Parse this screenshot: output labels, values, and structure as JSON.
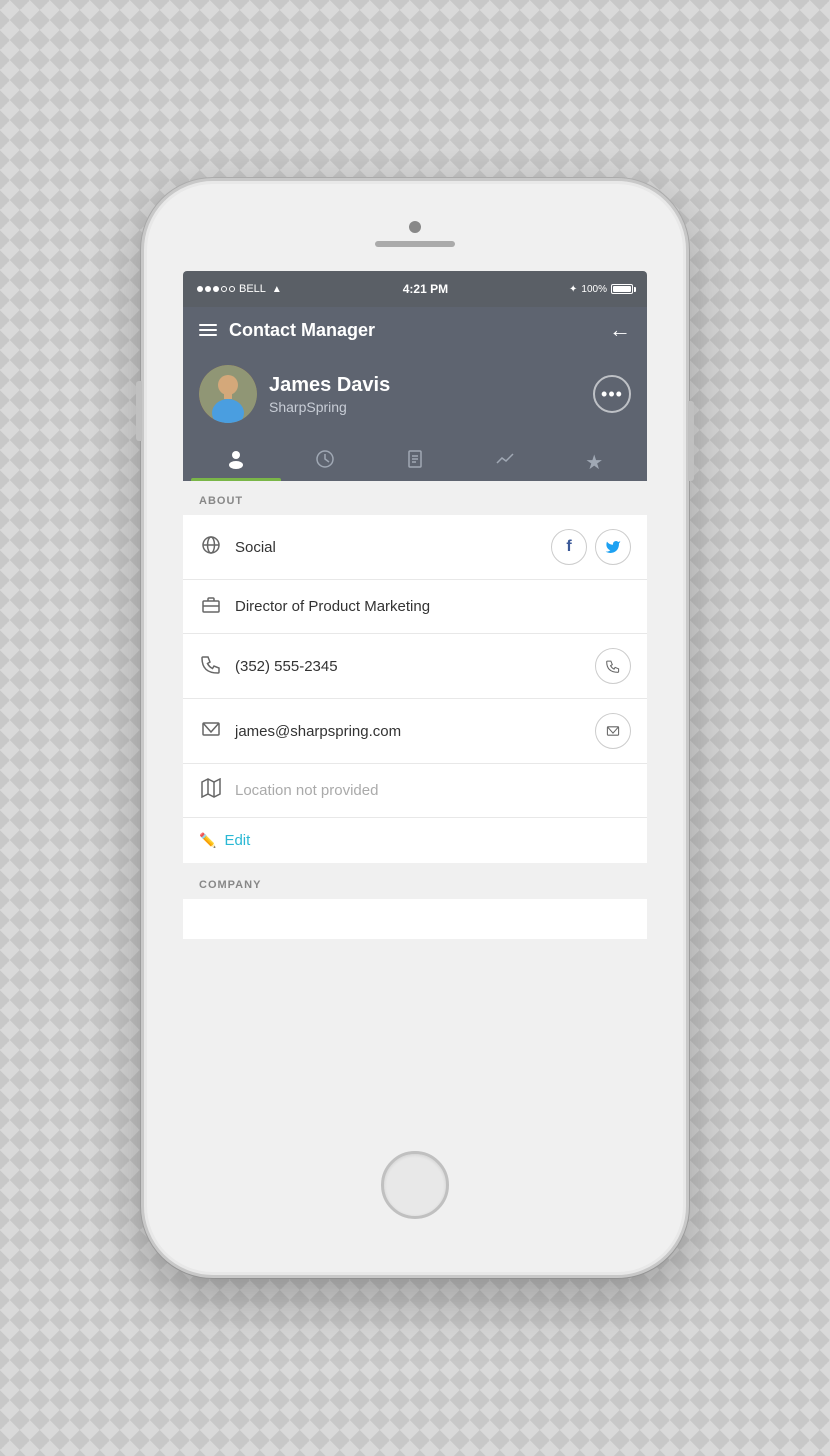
{
  "status_bar": {
    "carrier": "BELL",
    "time": "4:21 PM",
    "battery": "100%"
  },
  "header": {
    "title": "Contact Manager",
    "back_label": "←"
  },
  "contact": {
    "name": "James Davis",
    "company": "SharpSpring",
    "more_button_label": "•••"
  },
  "tabs": [
    {
      "id": "person",
      "icon": "👤",
      "active": true
    },
    {
      "id": "clock",
      "icon": "🕐",
      "active": false
    },
    {
      "id": "doc",
      "icon": "📄",
      "active": false
    },
    {
      "id": "chart",
      "icon": "📈",
      "active": false
    },
    {
      "id": "star",
      "icon": "★",
      "active": false
    }
  ],
  "about_section": {
    "label": "ABOUT",
    "rows": [
      {
        "type": "social",
        "icon": "🌐",
        "text": "Social",
        "actions": [
          "f",
          "🐦"
        ]
      },
      {
        "type": "job",
        "icon": "💼",
        "text": "Director of Product Marketing",
        "actions": []
      },
      {
        "type": "phone",
        "icon": "📞",
        "text": "(352) 555-2345",
        "actions": [
          "📞"
        ]
      },
      {
        "type": "email",
        "icon": "✉",
        "text": "james@sharpspring.com",
        "actions": [
          "✉"
        ]
      },
      {
        "type": "location",
        "icon": "🗺",
        "text": "Location not provided",
        "muted": true,
        "actions": []
      }
    ],
    "edit_label": "Edit",
    "edit_icon": "✏"
  },
  "company_section": {
    "label": "COMPANY"
  }
}
